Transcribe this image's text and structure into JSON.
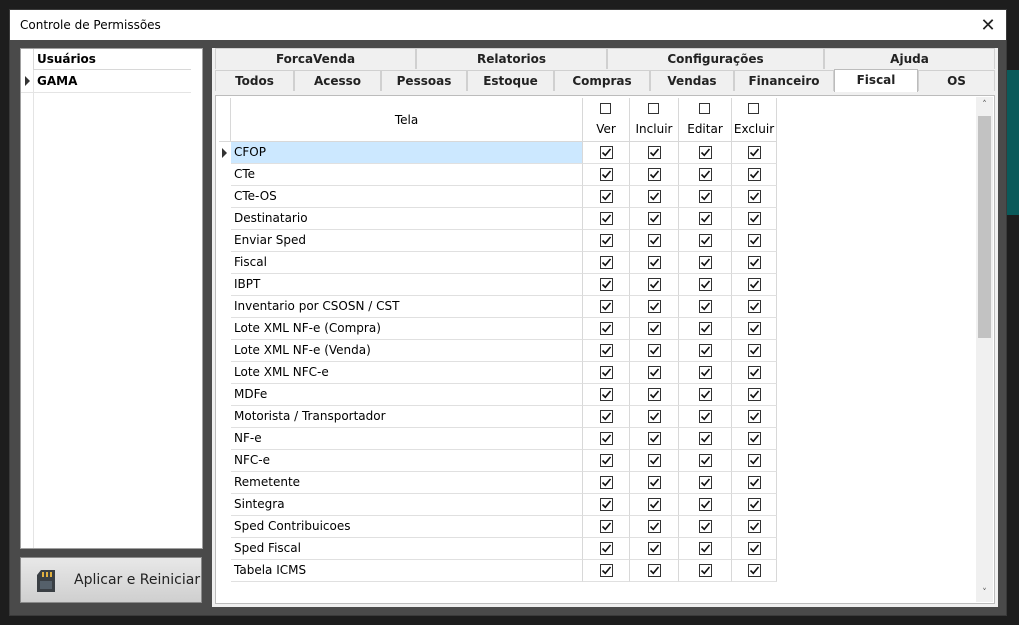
{
  "window": {
    "title": "Controle de Permissões"
  },
  "users": {
    "header": "Usuários",
    "rows": [
      {
        "name": "GAMA"
      }
    ]
  },
  "apply_button": {
    "label": "Aplicar e Reiniciar",
    "icon": "sd-card-icon"
  },
  "tabs_row1": [
    {
      "label": "ForcaVenda"
    },
    {
      "label": "Relatorios"
    },
    {
      "label": "Configurações"
    },
    {
      "label": "Ajuda"
    }
  ],
  "tabs_row2": [
    {
      "label": "Todos"
    },
    {
      "label": "Acesso"
    },
    {
      "label": "Pessoas"
    },
    {
      "label": "Estoque"
    },
    {
      "label": "Compras"
    },
    {
      "label": "Vendas"
    },
    {
      "label": "Financeiro"
    },
    {
      "label": "Fiscal",
      "active": true
    },
    {
      "label": "OS"
    }
  ],
  "grid": {
    "columns": {
      "tela": "Tela",
      "ver": "Ver",
      "incluir": "Incluir",
      "editar": "Editar",
      "excluir": "Excluir"
    },
    "header_checkboxes": {
      "ver": false,
      "incluir": false,
      "editar": false,
      "excluir": false
    },
    "rows": [
      {
        "tela": "CFOP",
        "ver": true,
        "incluir": true,
        "editar": true,
        "excluir": true,
        "selected": true
      },
      {
        "tela": "CTe",
        "ver": true,
        "incluir": true,
        "editar": true,
        "excluir": true
      },
      {
        "tela": "CTe-OS",
        "ver": true,
        "incluir": true,
        "editar": true,
        "excluir": true
      },
      {
        "tela": "Destinatario",
        "ver": true,
        "incluir": true,
        "editar": true,
        "excluir": true
      },
      {
        "tela": "Enviar Sped",
        "ver": true,
        "incluir": true,
        "editar": true,
        "excluir": true
      },
      {
        "tela": "Fiscal",
        "ver": true,
        "incluir": true,
        "editar": true,
        "excluir": true
      },
      {
        "tela": "IBPT",
        "ver": true,
        "incluir": true,
        "editar": true,
        "excluir": true
      },
      {
        "tela": "Inventario por CSOSN / CST",
        "ver": true,
        "incluir": true,
        "editar": true,
        "excluir": true
      },
      {
        "tela": "Lote XML NF-e (Compra)",
        "ver": true,
        "incluir": true,
        "editar": true,
        "excluir": true
      },
      {
        "tela": "Lote XML NF-e (Venda)",
        "ver": true,
        "incluir": true,
        "editar": true,
        "excluir": true
      },
      {
        "tela": "Lote XML NFC-e",
        "ver": true,
        "incluir": true,
        "editar": true,
        "excluir": true
      },
      {
        "tela": "MDFe",
        "ver": true,
        "incluir": true,
        "editar": true,
        "excluir": true
      },
      {
        "tela": "Motorista / Transportador",
        "ver": true,
        "incluir": true,
        "editar": true,
        "excluir": true
      },
      {
        "tela": "NF-e",
        "ver": true,
        "incluir": true,
        "editar": true,
        "excluir": true
      },
      {
        "tela": "NFC-e",
        "ver": true,
        "incluir": true,
        "editar": true,
        "excluir": true
      },
      {
        "tela": "Remetente",
        "ver": true,
        "incluir": true,
        "editar": true,
        "excluir": true
      },
      {
        "tela": "Sintegra",
        "ver": true,
        "incluir": true,
        "editar": true,
        "excluir": true
      },
      {
        "tela": "Sped Contribuicoes",
        "ver": true,
        "incluir": true,
        "editar": true,
        "excluir": true
      },
      {
        "tela": "Sped Fiscal",
        "ver": true,
        "incluir": true,
        "editar": true,
        "excluir": true
      },
      {
        "tela": "Tabela ICMS",
        "ver": true,
        "incluir": true,
        "editar": true,
        "excluir": true
      }
    ]
  },
  "colors": {
    "selection": "#cce8ff",
    "window_frame": "#4a4a4a",
    "scroll_thumb": "#c2c2c2"
  }
}
